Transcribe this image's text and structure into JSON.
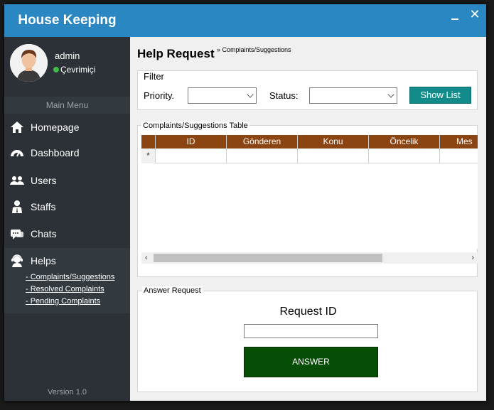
{
  "app": {
    "title": "House Keeping"
  },
  "user": {
    "name": "admin",
    "status": "Çevrimiçi"
  },
  "sidebar": {
    "menu_header": "Main Menu",
    "items": [
      {
        "label": "Homepage",
        "icon": "home-icon"
      },
      {
        "label": "Dashboard",
        "icon": "speedometer-icon"
      },
      {
        "label": "Users",
        "icon": "users-icon"
      },
      {
        "label": "Staffs",
        "icon": "staff-icon"
      },
      {
        "label": "Chats",
        "icon": "chat-icon"
      },
      {
        "label": "Helps",
        "icon": "help-icon"
      }
    ],
    "help_links": [
      "- Complaints/Suggestions",
      "- Resolved Complaints",
      "- Pending Complaints"
    ],
    "version": "Version 1.0"
  },
  "page": {
    "title": "Help Request",
    "breadcrumb": "» Complaints/Suggestions"
  },
  "filter": {
    "legend": "Filter",
    "priority_label": "Priority.",
    "priority_value": "",
    "status_label": "Status:",
    "status_value": "",
    "show_button": "Show List"
  },
  "table": {
    "legend": "Complaints/Suggestions Table",
    "columns": [
      "ID",
      "Gönderen",
      "Konu",
      "Öncelik",
      "Mes"
    ],
    "new_row_marker": "*",
    "scroll_left": "‹",
    "scroll_right": "›"
  },
  "answer": {
    "legend": "Answer Request",
    "request_label": "Request ID",
    "request_value": "",
    "button": "ANSWER"
  },
  "colors": {
    "accent": "#2a87c1",
    "sidebar": "#2b3136",
    "table_header": "#8b4513",
    "show_button": "#128b8b",
    "answer_button": "#064d06",
    "online": "#3dbb4d"
  }
}
